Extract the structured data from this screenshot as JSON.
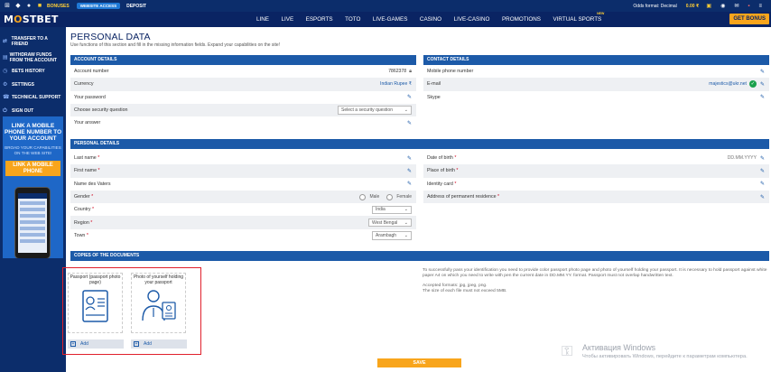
{
  "topbar": {
    "bonuses": "BONUSES",
    "website_access": "WEBSITE ACCESS",
    "deposit": "DEPOSIT",
    "odds_format": "Odds format: Decimal",
    "balance": "0.00 ₹"
  },
  "header": {
    "logo_left": "M",
    "logo_o": "O",
    "logo_right": "STBET",
    "get_bonus": "GET BONUS",
    "nav": [
      {
        "label": "LINE"
      },
      {
        "label": "LIVE"
      },
      {
        "label": "ESPORTS"
      },
      {
        "label": "TOTO"
      },
      {
        "label": "LIVE-GAMES"
      },
      {
        "label": "CASINO"
      },
      {
        "label": "LIVE-CASINO"
      },
      {
        "label": "PROMOTIONS"
      },
      {
        "label": "VIRTUAL SPORTS",
        "badge": "NEW"
      }
    ]
  },
  "sidebar": {
    "items": [
      {
        "label": "TRANSFER TO A FRIEND",
        "icon": "transfer-icon"
      },
      {
        "label": "WITHDRAW FUNDS FROM THE ACCOUNT",
        "icon": "withdraw-icon"
      },
      {
        "label": "BETS HISTORY",
        "icon": "history-icon"
      },
      {
        "label": "SETTINGS",
        "icon": "gear-icon"
      },
      {
        "label": "TECHNICAL SUPPORT",
        "icon": "support-icon"
      },
      {
        "label": "SIGN OUT",
        "icon": "signout-icon"
      }
    ],
    "promo": {
      "title": "LINK A MOBILE PHONE NUMBER TO YOUR ACCOUNT",
      "subtitle": "BROAD YOUR CAPABILITIES ON THE WEB SITE!",
      "button": "LINK A MOBILE PHONE"
    }
  },
  "page": {
    "title": "PERSONAL DATA",
    "subtitle": "Use functions of this section and fill in the missing information fields. Expand your capabilities on the site!"
  },
  "account": {
    "header": "ACCOUNT DETAILS",
    "number_label": "Account number",
    "number_value": "7862378",
    "currency_label": "Currency",
    "currency_value": "Indian Rupee ₹",
    "password_label": "Your password",
    "question_label": "Choose security question",
    "question_placeholder": "Select a security question",
    "answer_label": "Your answer"
  },
  "contact": {
    "header": "CONTACT DETAILS",
    "phone_label": "Mobile phone number",
    "email_label": "E-mail",
    "email_value": "majestics@ukr.net",
    "skype_label": "Skype"
  },
  "personal": {
    "header": "PERSONAL DETAILS",
    "last_name": "Last name",
    "first_name": "First name",
    "middle_name": "Name des Vaters",
    "gender": "Gender",
    "gender_male": "Male",
    "gender_female": "Female",
    "country": "Country",
    "country_value": "India",
    "region": "Region",
    "region_value": "West Bengal",
    "town": "Town",
    "town_value": "Arambagh",
    "dob": "Date of birth",
    "dob_value": "DD.MM.YYYY",
    "pob": "Place of birth",
    "id_card": "Identity card",
    "address": "Address of permanent residence",
    "required_mark": "*"
  },
  "documents": {
    "header": "COPIES OF THE DOCUMENTS",
    "passport_label": "Passport (passport photo page)",
    "selfie_label": "Photo of yourself holding your passport",
    "add_label": "Add",
    "info_1": "To successfully pass your identification you need to provide color passport photo page and photo of yourself holding your passport. It is necessary to hold passport against white paper A4 on which you need to write with pen the current date in DD.MM.YY. format. Passport must not overlap handwritten text.",
    "info_2": "Accepted formats: jpg, jpeg, png.",
    "info_3": "The size of each file must not exceed 5MB."
  },
  "save_button": "SAVE",
  "watermark": {
    "line1": "Активация Windows",
    "line2": "Чтобы активировать Windows, перейдите к параметрам компьютера."
  },
  "colors": {
    "brand": "#0a2463",
    "accent": "#f8a51c",
    "section": "#1c5aa8",
    "highlight": "#e0202c"
  }
}
